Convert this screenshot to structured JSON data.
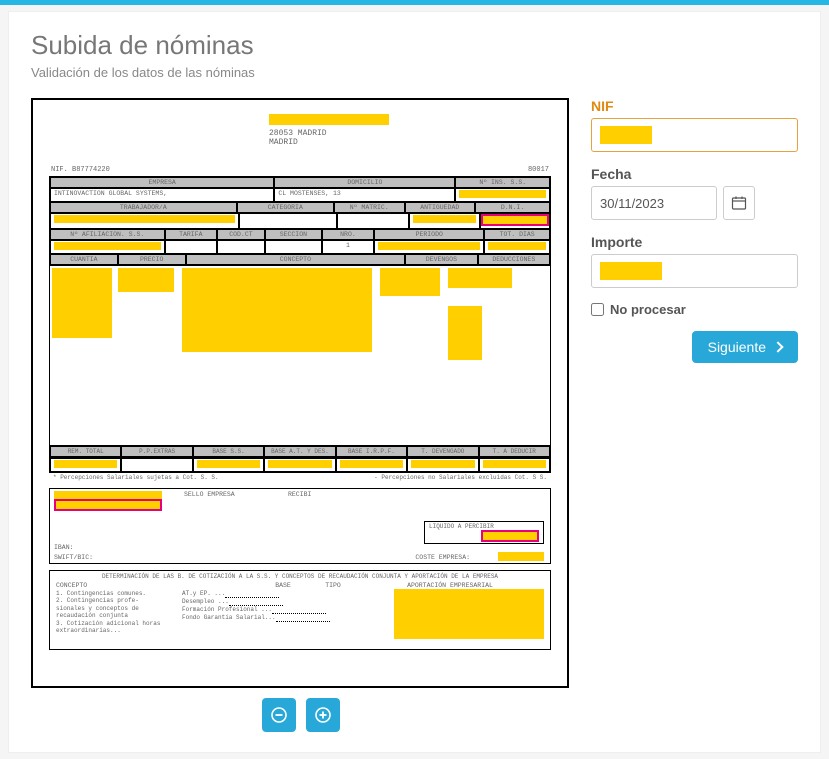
{
  "page": {
    "title": "Subida de nóminas",
    "subtitle": "Validación de los datos de las nóminas"
  },
  "document": {
    "address_postal": "28053  MADRID",
    "address_city": "MADRID",
    "nif_label": "NIF.",
    "nif_value": "B87774220",
    "tat_code": "80017",
    "headers": {
      "empresa": "EMPRESA",
      "domicilio": "DOMICILIO",
      "n_ins_ss": "Nº INS. S.S.",
      "trabajador": "TRABAJADOR/A",
      "categoria": "CATEGORIA",
      "n_matric": "Nº MATRIC.",
      "antiguedad": "ANTIGUEDAD",
      "dni": "D.N.I.",
      "afiliacion": "Nº AFILIACION. S.S.",
      "tarifa": "TARIFA",
      "codct": "COD.CT",
      "seccion": "SECCION",
      "nro": "NRO.",
      "periodo": "PERIODO",
      "tot_dias": "TOT. DIAS",
      "cuantia": "CUANTIA",
      "precio": "PRECIO",
      "concepto": "CONCEPTO",
      "devengos": "DEVENGOS",
      "deducciones": "DEDUCCIONES"
    },
    "empresa_name": "INTINOVACTION GLOBAL SYSTEMS,",
    "domicilio_val": "CL MOSTENSES, 13",
    "nro_val": "1",
    "totals": {
      "rem_total": "REM. TOTAL",
      "pp_extras": "P.P.EXTRAS",
      "base_ss": "BASE S.S.",
      "base_at": "BASE A.T. Y DES.",
      "base_irpf": "BASE I.R.P.F.",
      "t_devengado": "T. DEVENGADO",
      "t_deducir": "T. A DEDUCIR"
    },
    "footnote_left": "* Percepciones Salariales  sujetas a Cot. S. S.",
    "footnote_right": "- Percepciones no Salariales excluidas Cot. S S.",
    "sig": {
      "sello": "SELLO EMPRESA",
      "recibi": "RECIBI",
      "liquido": "LIQUIDO A PERCIBIR",
      "iban": "IBAN:",
      "swift": "SWIFT/BIC:",
      "coste": "COSTE EMPRESA:"
    },
    "cot": {
      "title": "DETERMINACIÓN DE LAS B. DE COTIZACIÓN A LA S.S. Y CONCEPTOS DE RECAUDACIÓN CONJUNTA Y APORTACIÓN DE LA EMPRESA",
      "col_concepto": "CONCEPTO",
      "col_base": "BASE",
      "col_tipo": "TIPO",
      "col_aport": "APORTACIÓN EMPRESARIAL",
      "l1": "1. Contingencias comunes.",
      "l2a": "2. Contingencias profe-",
      "l2b": "sionales y conceptos de",
      "l2c": "recaudación conjunta",
      "l3": "3. Cotización adicional horas extraordinarias...",
      "m1": "AT.y EP. ...",
      "m2": "Desempleo ...",
      "m3": "Formación Profesional ...",
      "m4": "Fondo Garantía Salarial..."
    }
  },
  "form": {
    "nif_label": "NIF",
    "fecha_label": "Fecha",
    "fecha_value": "30/11/2023",
    "importe_label": "Importe",
    "no_procesar_label": "No procesar",
    "siguiente_label": "Siguiente"
  },
  "controls": {
    "zoom_out": "−",
    "zoom_in": "+"
  }
}
